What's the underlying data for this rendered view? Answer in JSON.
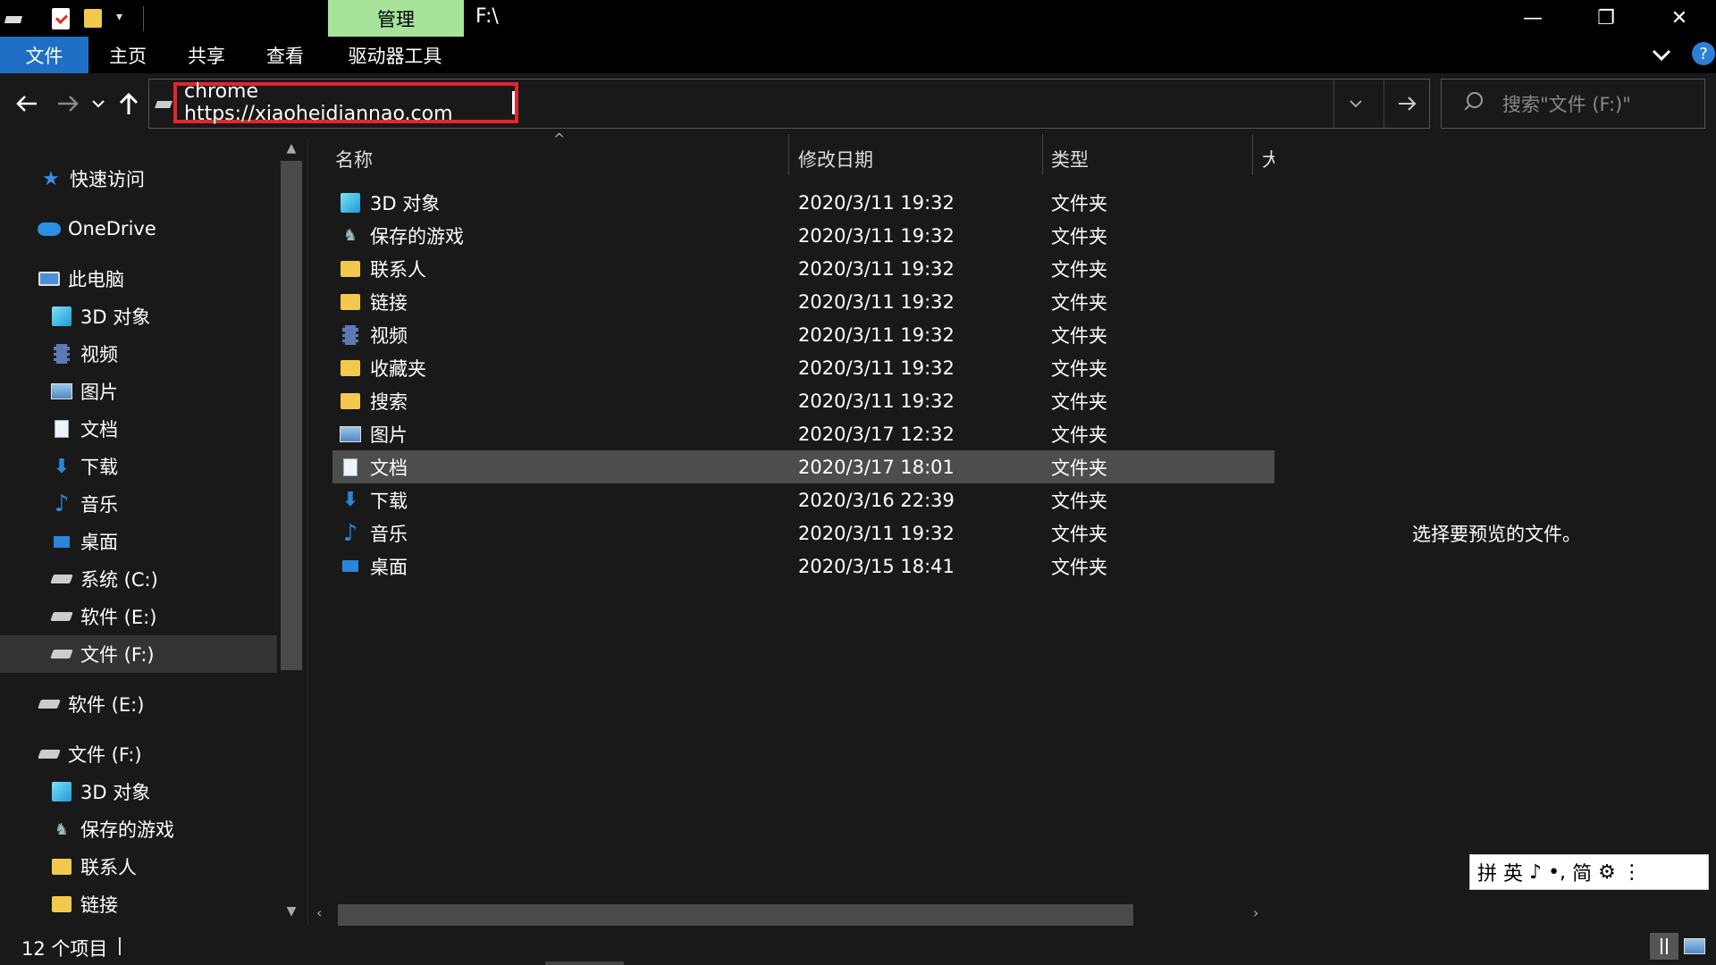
{
  "titlebar": {
    "context_tab": "管理",
    "window_title": "F:\\",
    "minimize": "—",
    "maximize": "❐",
    "close": "✕"
  },
  "ribbon": {
    "tabs": [
      "文件",
      "主页",
      "共享",
      "查看",
      "驱动器工具"
    ],
    "expand_icon": "chevron-down-icon",
    "help": "?"
  },
  "address": {
    "value": "chrome https://xiaoheidiannao.com",
    "search_placeholder": "搜索\"文件 (F:)\""
  },
  "nav_pane": {
    "items": [
      {
        "label": "快速访问",
        "icon": "star-icon"
      },
      {
        "label": "OneDrive",
        "icon": "cloud-icon"
      },
      {
        "label": "此电脑",
        "icon": "computer-icon"
      },
      {
        "label": "3D 对象",
        "icon": "cube-icon"
      },
      {
        "label": "视频",
        "icon": "video-icon"
      },
      {
        "label": "图片",
        "icon": "picture-icon"
      },
      {
        "label": "文档",
        "icon": "document-icon"
      },
      {
        "label": "下载",
        "icon": "download-icon"
      },
      {
        "label": "音乐",
        "icon": "music-icon"
      },
      {
        "label": "桌面",
        "icon": "desktop-icon"
      },
      {
        "label": "系统 (C:)",
        "icon": "drive-icon"
      },
      {
        "label": "软件 (E:)",
        "icon": "drive-icon"
      },
      {
        "label": "文件 (F:)",
        "icon": "drive-icon",
        "selected": true
      },
      {
        "label": "软件 (E:)",
        "icon": "drive-icon"
      },
      {
        "label": "文件 (F:)",
        "icon": "drive-icon"
      },
      {
        "label": "3D 对象",
        "icon": "cube-icon"
      },
      {
        "label": "保存的游戏",
        "icon": "saved-games-icon"
      },
      {
        "label": "联系人",
        "icon": "contacts-icon"
      },
      {
        "label": "链接",
        "icon": "links-icon"
      }
    ]
  },
  "file_list": {
    "columns": [
      "名称",
      "修改日期",
      "类型",
      "大"
    ],
    "rows": [
      {
        "name": "3D 对象",
        "date": "2020/3/11 19:32",
        "type": "文件夹",
        "icon": "cube-icon"
      },
      {
        "name": "保存的游戏",
        "date": "2020/3/11 19:32",
        "type": "文件夹",
        "icon": "saved-games-icon"
      },
      {
        "name": "联系人",
        "date": "2020/3/11 19:32",
        "type": "文件夹",
        "icon": "contacts-icon"
      },
      {
        "name": "链接",
        "date": "2020/3/11 19:32",
        "type": "文件夹",
        "icon": "links-icon"
      },
      {
        "name": "视频",
        "date": "2020/3/11 19:32",
        "type": "文件夹",
        "icon": "video-icon"
      },
      {
        "name": "收藏夹",
        "date": "2020/3/11 19:32",
        "type": "文件夹",
        "icon": "favorites-icon"
      },
      {
        "name": "搜索",
        "date": "2020/3/11 19:32",
        "type": "文件夹",
        "icon": "search-folder-icon"
      },
      {
        "name": "图片",
        "date": "2020/3/17 12:32",
        "type": "文件夹",
        "icon": "picture-icon"
      },
      {
        "name": "文档",
        "date": "2020/3/17 18:01",
        "type": "文件夹",
        "icon": "document-icon",
        "selected": true
      },
      {
        "name": "下载",
        "date": "2020/3/16 22:39",
        "type": "文件夹",
        "icon": "download-icon"
      },
      {
        "name": "音乐",
        "date": "2020/3/11 19:32",
        "type": "文件夹",
        "icon": "music-icon"
      },
      {
        "name": "桌面",
        "date": "2020/3/15 18:41",
        "type": "文件夹",
        "icon": "desktop-icon"
      }
    ]
  },
  "preview": {
    "message": "选择要预览的文件。"
  },
  "ime": {
    "items": [
      "拼",
      "英",
      "♪",
      "•,",
      "简",
      "⚙",
      "⋮"
    ]
  },
  "status": {
    "count": "12 个项目"
  },
  "colors": {
    "background": "#191919",
    "file_tab": "#1f6fc5",
    "context_tab": "#a7e39b",
    "highlight_box": "#e2262d",
    "selected_row": "#4d4d4d"
  }
}
